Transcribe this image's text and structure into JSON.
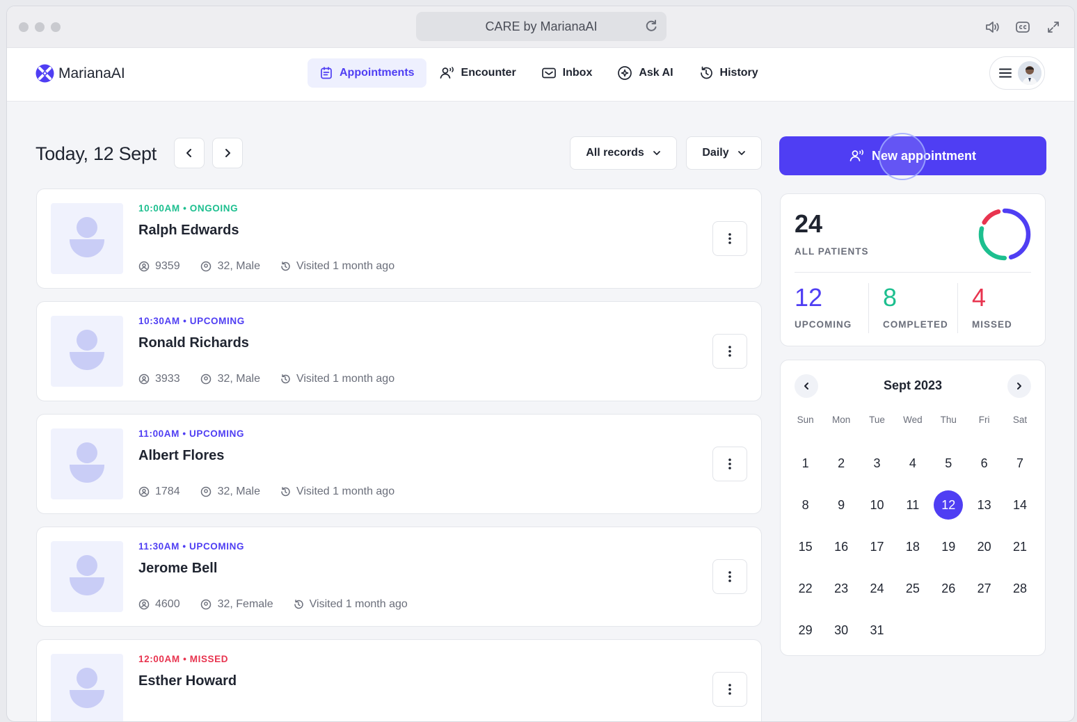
{
  "window": {
    "url_title": "CARE by MarianaAI"
  },
  "app": {
    "brand": "MarianaAI",
    "nav": [
      {
        "label": "Appointments",
        "icon": "calendar-list-icon",
        "active": true
      },
      {
        "label": "Encounter",
        "icon": "user-wave-icon",
        "active": false
      },
      {
        "label": "Inbox",
        "icon": "mail-icon",
        "active": false
      },
      {
        "label": "Ask AI",
        "icon": "ai-sparkle-icon",
        "active": false
      },
      {
        "label": "History",
        "icon": "history-icon",
        "active": false
      }
    ]
  },
  "page": {
    "title": "Today, 12 Sept",
    "filter_records": "All records",
    "filter_period": "Daily",
    "new_appointment": "New appointment"
  },
  "appointments": [
    {
      "status": "10:00AM • ONGOING",
      "status_color": "#1dbf8f",
      "name": "Ralph Edwards",
      "id": "9359",
      "demo": "32, Male",
      "visit": "Visited 1 month ago"
    },
    {
      "status": "10:30AM • UPCOMING",
      "status_color": "#4f3ef3",
      "name": "Ronald Richards",
      "id": "3933",
      "demo": "32, Male",
      "visit": "Visited 1 month ago"
    },
    {
      "status": "11:00AM • UPCOMING",
      "status_color": "#4f3ef3",
      "name": "Albert Flores",
      "id": "1784",
      "demo": "32, Male",
      "visit": "Visited 1 month ago"
    },
    {
      "status": "11:30AM • UPCOMING",
      "status_color": "#4f3ef3",
      "name": "Jerome Bell",
      "id": "4600",
      "demo": "32, Female",
      "visit": "Visited 1 month ago"
    },
    {
      "status": "12:00AM • MISSED",
      "status_color": "#e8344f",
      "name": "Esther Howard",
      "id": "",
      "demo": "",
      "visit": ""
    }
  ],
  "stats": {
    "total": "24",
    "total_label": "ALL PATIENTS",
    "upcoming": "12",
    "upcoming_label": "UPCOMING",
    "completed": "8",
    "completed_label": "COMPLETED",
    "missed": "4",
    "missed_label": "MISSED",
    "colors": {
      "upcoming": "#4f3ef3",
      "completed": "#1dbf8f",
      "missed": "#e8344f"
    }
  },
  "calendar": {
    "title": "Sept 2023",
    "weekdays": [
      "Sun",
      "Mon",
      "Tue",
      "Wed",
      "Thu",
      "Fri",
      "Sat"
    ],
    "first_weekday_index": 5,
    "days_in_month": 31,
    "selected_day": 12
  }
}
